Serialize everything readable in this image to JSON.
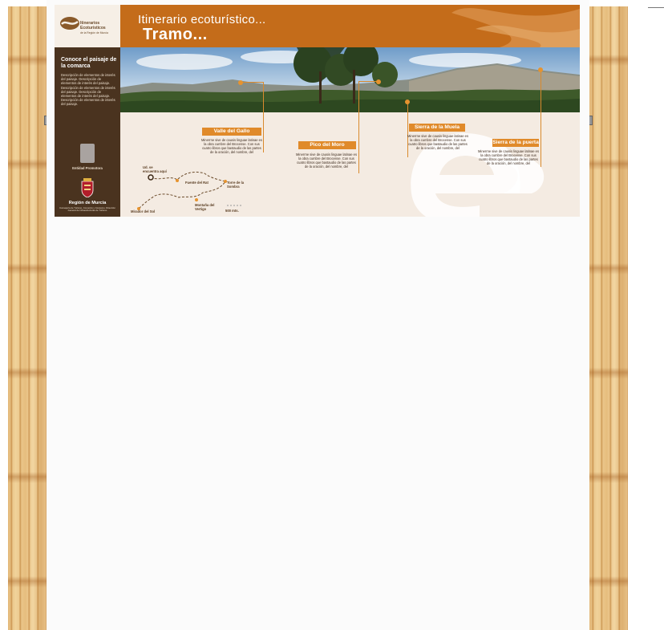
{
  "colors": {
    "header_orange": "#c46c1a",
    "tag_orange": "#e08a2a",
    "sidebar_brown": "#4a331f",
    "panel_beige": "#f4ebe2",
    "post_wood": "#e8c188"
  },
  "header": {
    "title": "Itinerario ecoturístico...",
    "subtitle": "Tramo..."
  },
  "logo": {
    "line1": "Itinerarios",
    "line2": "Ecoturísticos",
    "line3": "de la Región de Murcia"
  },
  "sidebar": {
    "heading": "Conoce el paisaje de la comarca",
    "text": "Descripción de elementos de interés del paisaje. Descripción de elementos de interés del paisaje. Descripción de elementos de interés del paisaje. Descripción de elementos de interés del paisaje. Descripción de elementos de interés del paisaje.",
    "entity_label": "Entidad Promotora",
    "region_name": "Región de Murcia",
    "region_sub": "Consejería de Turismo, Comercio y Consumo. Dirección General de Infraestructuras de Turismo"
  },
  "points": [
    {
      "name": "Valle del Gallo",
      "text": "Minerrne sive de causis linguae latinae es la obra cumbre del Brocense. Con sus cuatro libros que bastaudio de las partes de la oración, del nombre, del"
    },
    {
      "name": "Pico del Moro",
      "text": "Minerrne sive de causis linguae latinae es la obra cumbre del Brocense. Con sus cuatro libros que bastaudio de las partes de la oración, del nombre, del"
    },
    {
      "name": "Sierra de la Muela",
      "text": "Minerrne sive de causis linguae latinae es la obra cumbre del Brocense. Con sus cuatro libros que bastaudio de las partes de la oración, del nombre, del"
    },
    {
      "name": "Sierra de la puerta",
      "text": "Minerrne sive de causis linguae latinae es la obra cumbre del Brocense. Con sus cuatro libros que bastaudio de las partes de la oración, del nombre, del"
    }
  ],
  "map": {
    "you_are_here": "Ud. se encuentra aquí",
    "fuente": "Fuente del Rat",
    "torre": "Torre de la Sombra",
    "mirador": "Mirador del Sol",
    "montana": "Montaña del Vertigo",
    "scale": "500 mts."
  }
}
